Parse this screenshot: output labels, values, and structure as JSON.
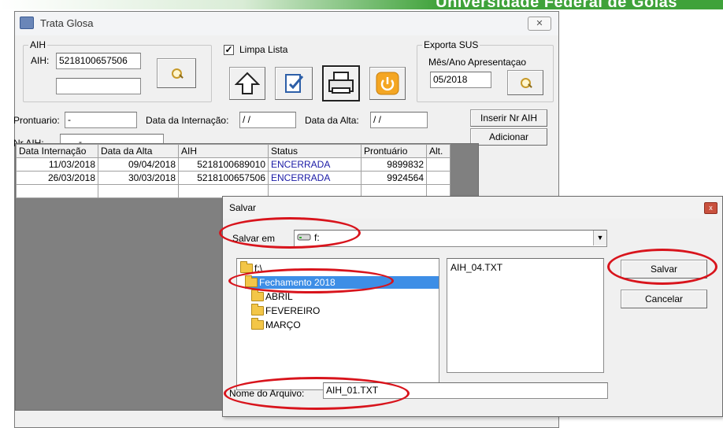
{
  "banner": {
    "text": "Universidade Federal de Goiás"
  },
  "main_window": {
    "title": "Trata Glosa",
    "close_glyph": "✕",
    "aih_group": {
      "legend": "AIH",
      "label": "AIH:",
      "aih_value": "5218100657506",
      "second_value": ""
    },
    "limpa_lista": {
      "label": "Limpa Lista",
      "checked": true,
      "check_glyph": "✓"
    },
    "exporta_group": {
      "legend": "Exporta SUS",
      "label": "Mês/Ano Apresentaçao",
      "value": "05/2018"
    },
    "fields": {
      "prontuario_label": "Prontuario:",
      "prontuario_value": "   -",
      "data_internacao_label": "Data da Internação:",
      "data_internacao_value": " / /",
      "data_alta_label": "Data da Alta:",
      "data_alta_value": " / /",
      "nr_aih_label": "Nr AIH:",
      "nr_aih_value": "  .  .  .  -"
    },
    "buttons": {
      "inserir": "Inserir Nr AIH",
      "adicionar": "Adicionar"
    },
    "grid": {
      "headers": [
        "Data Internação",
        "Data da Alta",
        "AIH",
        "Status",
        "Prontuário",
        "Alt."
      ],
      "rows": [
        [
          "11/03/2018",
          "09/04/2018",
          "5218100689010",
          "ENCERRADA",
          "9899832",
          ""
        ],
        [
          "26/03/2018",
          "30/03/2018",
          "5218100657506",
          "ENCERRADA",
          "9924564",
          ""
        ]
      ]
    }
  },
  "save_dialog": {
    "title": "Salvar",
    "close_glyph": "x",
    "salvar_em_label": "Salvar em",
    "salvar_em_value": "f:",
    "dropdown_arrow": "▼",
    "folders": [
      "f:\\",
      "Fechamento 2018",
      "ABRIL",
      "FEVEREIRO",
      "MARÇO"
    ],
    "selected_folder": "Fechamento 2018",
    "files": [
      "AIH_04.TXT"
    ],
    "nome_label": "Nome do Arquivo:",
    "nome_value": "AIH_01.TXT",
    "salvar_button": "Salvar",
    "cancelar_button": "Cancelar"
  },
  "colors": {
    "highlight_oval": "#d8141c",
    "selection": "#3d8ee6",
    "status_text": "#1a1aa6"
  }
}
